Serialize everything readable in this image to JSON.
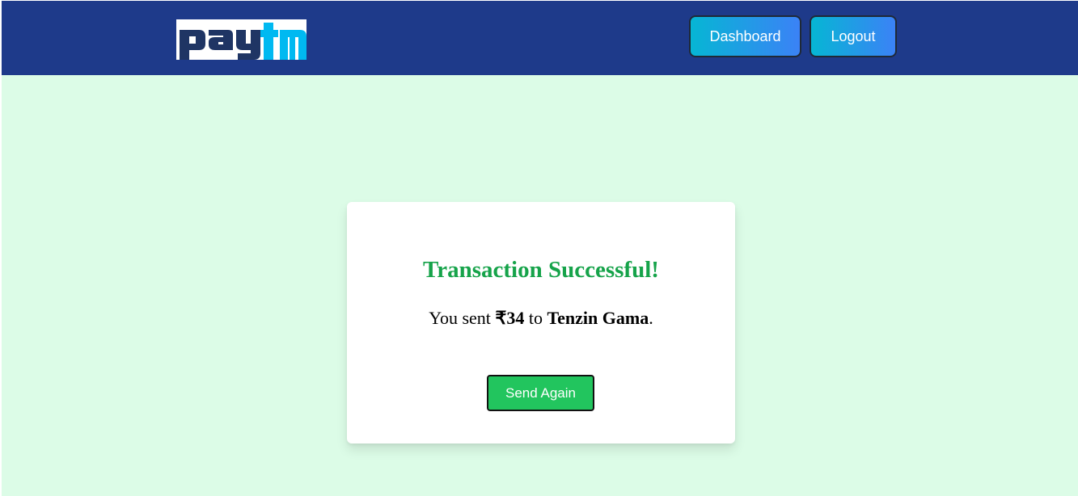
{
  "header": {
    "logo_text": "paytm",
    "logo_colors": {
      "pay": "#1f3564",
      "tm": "#00b9f1"
    },
    "nav": {
      "dashboard_label": "Dashboard",
      "logout_label": "Logout"
    }
  },
  "result": {
    "title": "Transaction Successful!",
    "message_prefix": "You sent ",
    "amount": "₹34",
    "message_middle": " to ",
    "recipient": "Tenzin Gama",
    "message_suffix": ".",
    "send_again_label": "Send Again"
  },
  "colors": {
    "header_bg": "#1e3a8a",
    "page_bg": "#dcfce7",
    "success_text": "#16a34a",
    "send_button": "#22c55e",
    "nav_gradient_start": "#06b6d4",
    "nav_gradient_end": "#3b82f6"
  }
}
